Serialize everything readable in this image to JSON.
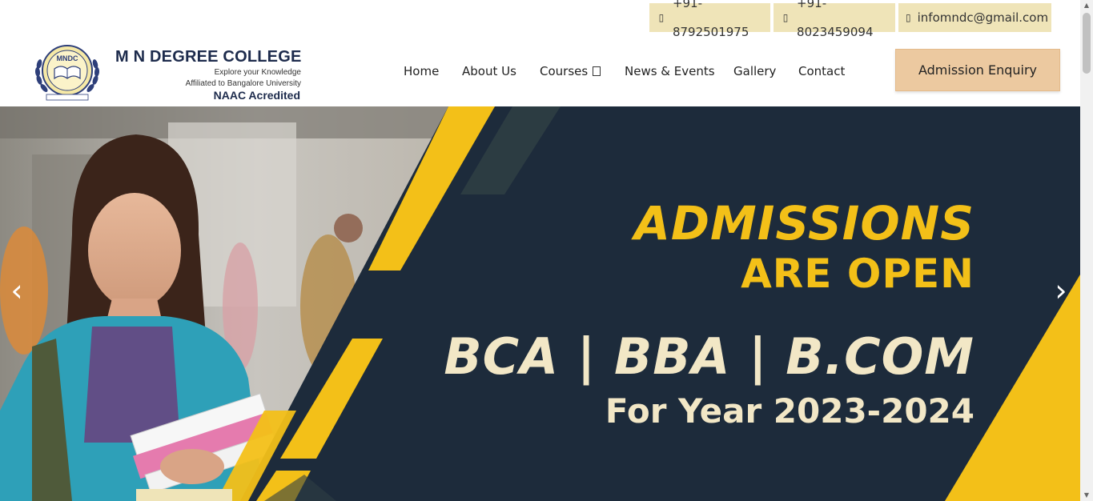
{
  "topbar": {
    "phone1": "+91-8792501975",
    "phone2": "+91-8023459094",
    "email": "infomndc@gmail.com",
    "phone_icon": "mobile-phone-icon",
    "email_icon": "envelope-icon"
  },
  "header": {
    "logo_text": "MNDC",
    "college_name": "M N DEGREE COLLEGE",
    "tagline": "Explore your Knowledge",
    "affiliation": "Affiliated to Bangalore University",
    "accreditation": "NAAC Acredited"
  },
  "nav": {
    "items": [
      {
        "label": "Home"
      },
      {
        "label": "About Us"
      },
      {
        "label": "Courses"
      },
      {
        "label": "News & Events"
      },
      {
        "label": "Gallery"
      },
      {
        "label": "Contact"
      }
    ]
  },
  "cta": {
    "label": "Admission Enquiry"
  },
  "banner": {
    "line1": "ADMISSIONS",
    "line2": "ARE OPEN",
    "line3": "BCA | BBA | B.COM",
    "line4": "For Year 2023-2024",
    "prev_symbol": "‹",
    "next_symbol": "›"
  },
  "colors": {
    "accent_yellow": "#f3c018",
    "navy": "#1d2b3b",
    "pill_bg": "#efe4b8",
    "cta_bg": "#ecc9a0"
  }
}
